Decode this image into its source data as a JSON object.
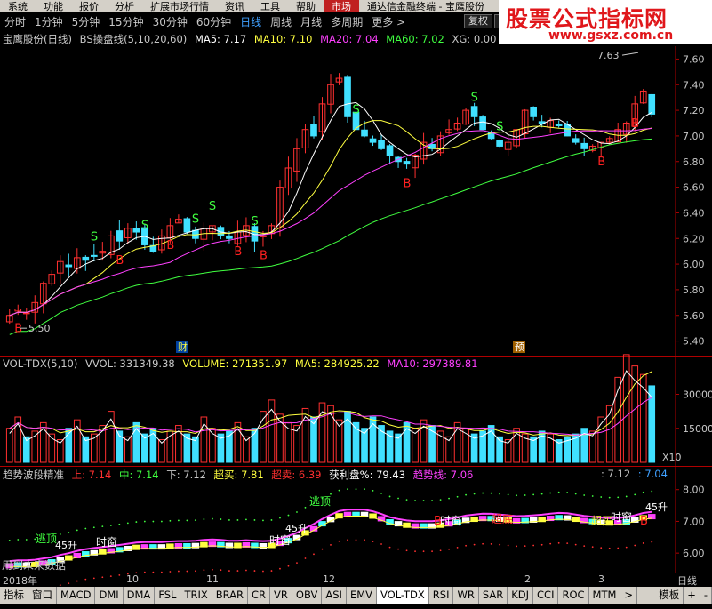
{
  "menu": {
    "items": [
      "系统",
      "功能",
      "报价",
      "分析",
      "扩展市场行情",
      "资讯",
      "工具",
      "帮助"
    ],
    "active_item": "市场",
    "right_text": "通达信金融终端 - 宝鹰股份"
  },
  "periods": {
    "items": [
      "分时",
      "1分钟",
      "5分钟",
      "15分钟",
      "30分钟",
      "60分钟",
      "日线",
      "周线",
      "月线",
      "多周期",
      "更多 >"
    ],
    "active": "日线",
    "restore_button": "复权",
    "overlay_button": "叠"
  },
  "watermark": {
    "title": "股票公式指标网",
    "url": "www.gsxz.com.cn"
  },
  "main_legend": {
    "name": "宝鹰股份(日线)",
    "indicator": "BS操盘线(5,10,20,60)",
    "ma5": "MA5: 7.17",
    "ma10": "MA10: 7.10",
    "ma20": "MA20: 7.04",
    "ma60": "MA60: 7.02",
    "xg": "XG: 0.00"
  },
  "vol_legend": {
    "name": "VOL-TDX(5,10)",
    "vvol": "VVOL: 331349.38",
    "volume": "VOLUME: 271351.97",
    "ma5": "MA5: 284925.22",
    "ma10": "MA10: 297389.81"
  },
  "trend_legend": {
    "name": "趋势波段精准",
    "shang": "上: 7.14",
    "zhong": "中: 7.14",
    "xia": "下: 7.12",
    "chaomai": "超买: 7.81",
    "chaomai2": "超卖: 6.39",
    "huoli": "获利盘%: 79.43",
    "qushi": "趋势线: 7.06",
    "right1": ": 7.12",
    "right2": ": 7.04"
  },
  "labels": {
    "high": "7.63",
    "low": "5.50",
    "cai": "财",
    "yu": "预",
    "x10": "X10",
    "future_note": "用到未来数据",
    "taodi": "逃顶",
    "shichuang": "时窗",
    "chaodi": "超底",
    "chaoxue": "超买",
    "sheng": "45升",
    "ding": "顶",
    "di": "底"
  },
  "bottom": {
    "year": "2018年",
    "months": [
      "10",
      "11",
      "12",
      "2",
      "3"
    ],
    "period_label": "日线"
  },
  "tabs": {
    "items": [
      "指标",
      "窗口",
      "MACD",
      "DMI",
      "DMA",
      "FSL",
      "TRIX",
      "BRAR",
      "CR",
      "VR",
      "OBV",
      "ASI",
      "EMV",
      "VOL-TDX",
      "RSI",
      "WR",
      "SAR",
      "KDJ",
      "CCI",
      "ROC",
      "MTM",
      ">",
      "模板",
      "+",
      "-"
    ],
    "active": "VOL-TDX"
  },
  "chart_data": [
    {
      "type": "candlestick",
      "title": "宝鹰股份(日线)",
      "ylim": [
        5.3,
        7.7
      ],
      "y_ticks": [
        5.4,
        5.6,
        5.8,
        6.0,
        6.2,
        6.4,
        6.6,
        6.8,
        7.0,
        7.2,
        7.4,
        7.6
      ],
      "annotations": {
        "high": 7.63,
        "low": 5.5
      },
      "signals": [
        "B",
        "S"
      ],
      "close_series": [
        5.6,
        5.65,
        5.62,
        5.7,
        5.85,
        5.92,
        6.02,
        5.98,
        6.05,
        6.03,
        6.06,
        6.1,
        6.22,
        6.18,
        6.28,
        6.25,
        6.15,
        6.1,
        6.22,
        6.3,
        6.35,
        6.25,
        6.2,
        6.28,
        6.3,
        6.22,
        6.2,
        6.25,
        6.3,
        6.18,
        6.22,
        6.3,
        6.6,
        6.75,
        6.9,
        7.05,
        7.0,
        7.25,
        7.4,
        7.45,
        7.15,
        7.05,
        7.0,
        6.95,
        6.9,
        6.85,
        6.8,
        6.78,
        6.85,
        6.95,
        6.9,
        7.0,
        7.05,
        7.1,
        7.2,
        7.15,
        7.05,
        6.98,
        6.92,
        6.95,
        7.05,
        7.2,
        7.15,
        7.1,
        7.12,
        7.08,
        7.0,
        6.95,
        6.9,
        6.92,
        6.95,
        6.98,
        7.05,
        7.1,
        7.25,
        7.35,
        7.17
      ]
    },
    {
      "type": "bar",
      "title": "VOL-TDX(5,10)",
      "ylim": [
        0,
        40000
      ],
      "y_ticks": [
        15000,
        30000
      ],
      "values": [
        12,
        16,
        9,
        11,
        14,
        10,
        8,
        12,
        15,
        9,
        10,
        13,
        18,
        11,
        9,
        14,
        10,
        12,
        8,
        11,
        13,
        10,
        9,
        16,
        12,
        10,
        11,
        14,
        9,
        12,
        18,
        22,
        17,
        14,
        13,
        19,
        16,
        21,
        20,
        15,
        18,
        14,
        12,
        16,
        13,
        11,
        10,
        14,
        12,
        15,
        13,
        11,
        9,
        14,
        12,
        10,
        11,
        13,
        9,
        8,
        12,
        10,
        9,
        11,
        10,
        8,
        9,
        10,
        12,
        11,
        16,
        20,
        30,
        38,
        34,
        31,
        27
      ]
    },
    {
      "type": "line",
      "title": "趋势波段精准",
      "ylim": [
        5.5,
        8.3
      ],
      "y_ticks": [
        6.0,
        7.0,
        8.0
      ]
    }
  ]
}
